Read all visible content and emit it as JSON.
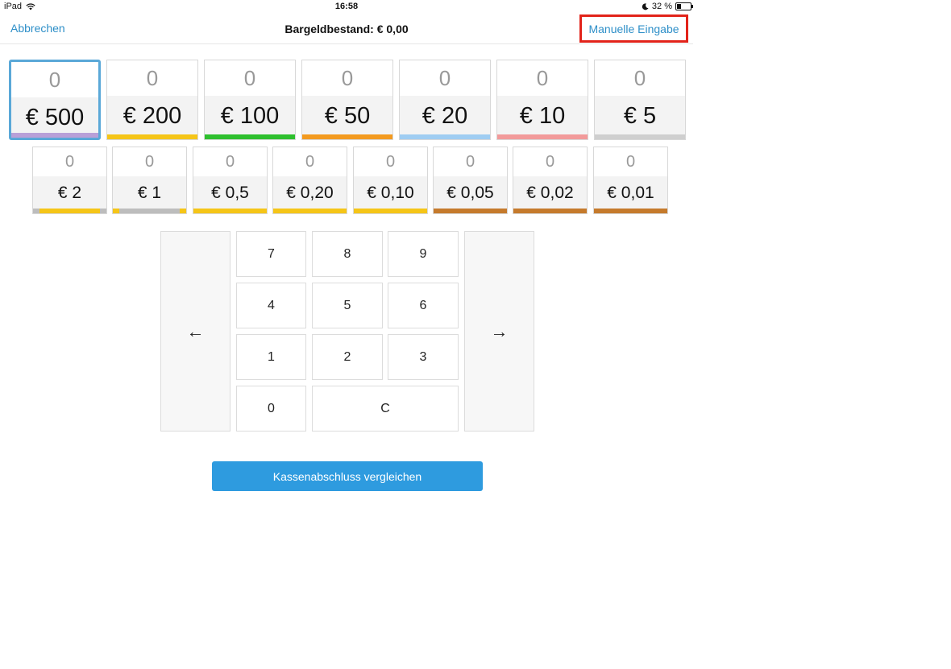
{
  "status_bar": {
    "device": "iPad",
    "time": "16:58",
    "battery_text": "32 %"
  },
  "nav": {
    "cancel_label": "Abbrechen",
    "title": "Bargeldbestand: € 0,00",
    "manual_label": "Manuelle Eingabe"
  },
  "denominations_large": [
    {
      "count": "0",
      "label": "€ 500",
      "color": "#b9a0d8",
      "selected": true
    },
    {
      "count": "0",
      "label": "€ 200",
      "color": "#f5c518"
    },
    {
      "count": "0",
      "label": "€ 100",
      "color": "#2ec02e"
    },
    {
      "count": "0",
      "label": "€ 50",
      "color": "#f39a1f"
    },
    {
      "count": "0",
      "label": "€ 20",
      "color": "#9fcdf2"
    },
    {
      "count": "0",
      "label": "€ 10",
      "color": "#f29a9a"
    },
    {
      "count": "0",
      "label": "€ 5",
      "color": "#cfcfcf"
    }
  ],
  "denominations_small": [
    {
      "count": "0",
      "label": "€ 2",
      "color": "#f5c518",
      "edge_color": "#bdbdbd"
    },
    {
      "count": "0",
      "label": "€ 1",
      "color": "#bdbdbd",
      "edge_color": "#f5c518"
    },
    {
      "count": "0",
      "label": "€ 0,5",
      "color": "#f5c518"
    },
    {
      "count": "0",
      "label": "€ 0,20",
      "color": "#f5c518"
    },
    {
      "count": "0",
      "label": "€ 0,10",
      "color": "#f5c518"
    },
    {
      "count": "0",
      "label": "€ 0,05",
      "color": "#c57a2c"
    },
    {
      "count": "0",
      "label": "€ 0,02",
      "color": "#c57a2c"
    },
    {
      "count": "0",
      "label": "€ 0,01",
      "color": "#c57a2c"
    }
  ],
  "keypad": {
    "left_arrow": "←",
    "right_arrow": "→",
    "k7": "7",
    "k8": "8",
    "k9": "9",
    "k4": "4",
    "k5": "5",
    "k6": "6",
    "k1": "1",
    "k2": "2",
    "k3": "3",
    "k0": "0",
    "clear": "C"
  },
  "compare_button_label": "Kassenabschluss vergleichen"
}
